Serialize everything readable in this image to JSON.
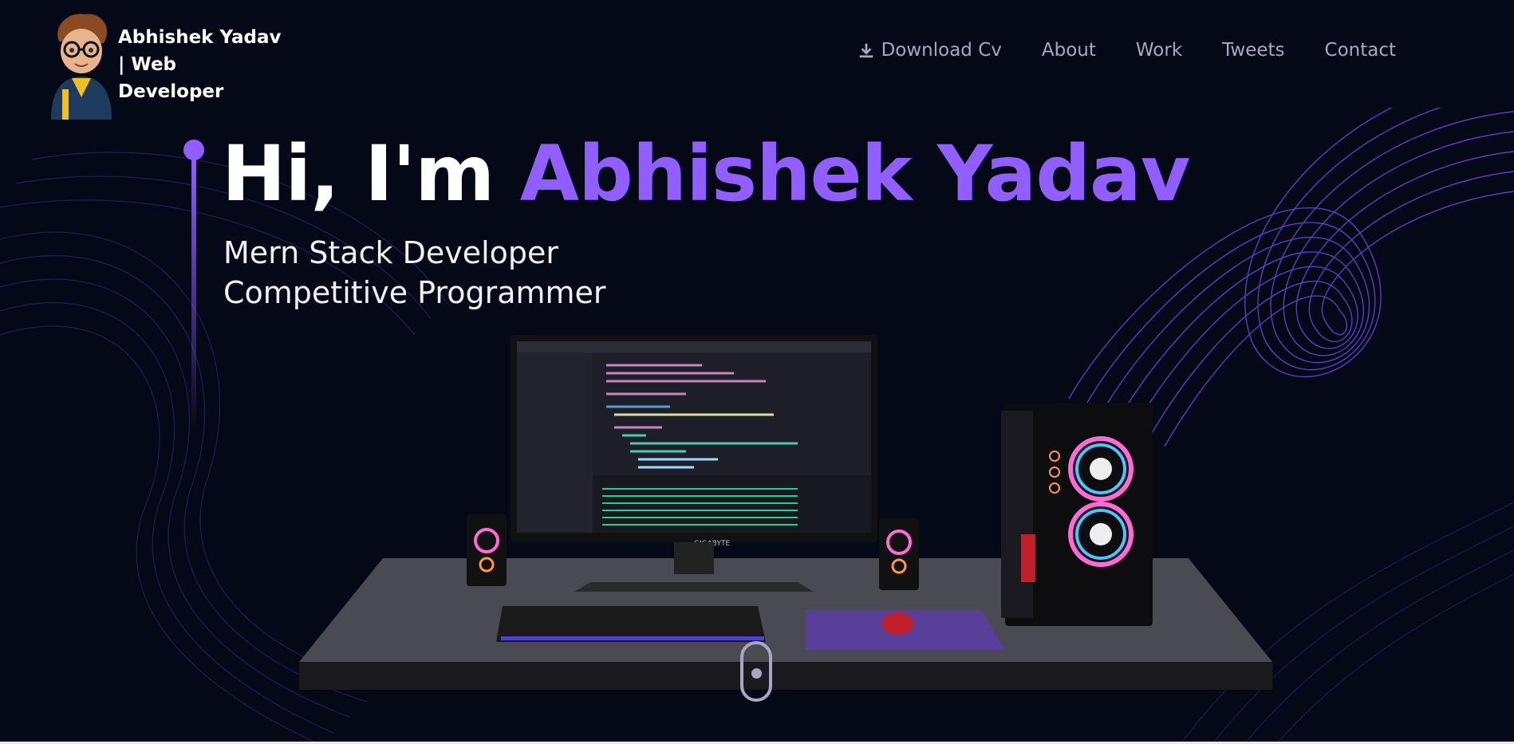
{
  "header": {
    "brand_line1": "Abhishek Yadav",
    "brand_line2": "| Web Developer",
    "nav": [
      {
        "label": "Download Cv",
        "icon": "download-icon"
      },
      {
        "label": "About"
      },
      {
        "label": "Work"
      },
      {
        "label": "Tweets"
      },
      {
        "label": "Contact"
      }
    ]
  },
  "hero": {
    "greeting": "Hi, I'm ",
    "name": "Abhishek Yadav",
    "subtitle_line1": "Mern Stack Developer",
    "subtitle_line2": "Competitive Programmer"
  },
  "scene": {
    "monitor_brand": "GIGABYTE"
  },
  "colors": {
    "background": "#050816",
    "accent": "#915eff",
    "nav_text": "#aaa6c3"
  }
}
